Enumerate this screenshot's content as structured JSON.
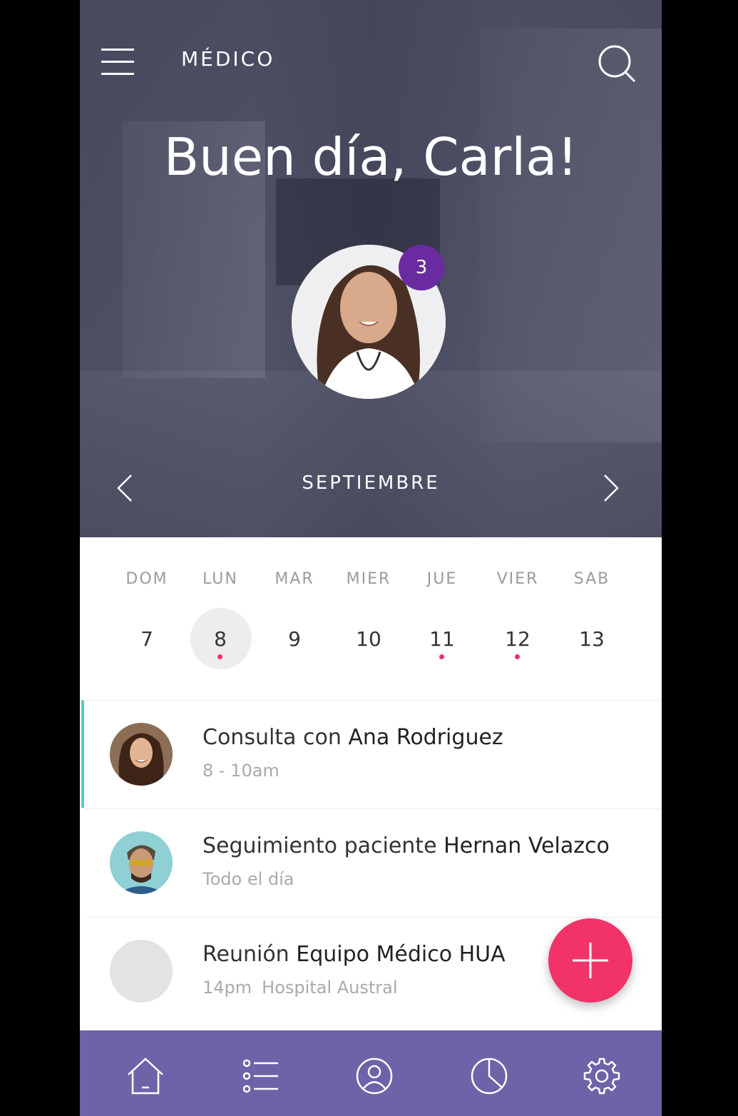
{
  "header": {
    "app_title": "MÉDICO",
    "greeting": "Buen día, Carla!",
    "notification_count": "3",
    "month": "SEPTIEMBRE"
  },
  "week": {
    "days": [
      {
        "dow": "DOM",
        "num": "7",
        "selected": false,
        "has_event": false
      },
      {
        "dow": "LUN",
        "num": "8",
        "selected": true,
        "has_event": true
      },
      {
        "dow": "MAR",
        "num": "9",
        "selected": false,
        "has_event": false
      },
      {
        "dow": "MIER",
        "num": "10",
        "selected": false,
        "has_event": false
      },
      {
        "dow": "JUE",
        "num": "11",
        "selected": false,
        "has_event": true
      },
      {
        "dow": "VIER",
        "num": "12",
        "selected": false,
        "has_event": true
      },
      {
        "dow": "SAB",
        "num": "13",
        "selected": false,
        "has_event": false
      }
    ]
  },
  "events": [
    {
      "prefix": "Consulta con ",
      "name": "Ana Rodriguez",
      "time": "8 - 10am",
      "place": ""
    },
    {
      "prefix": "Seguimiento paciente ",
      "name": "Hernan Velazco",
      "time": "Todo el día",
      "place": ""
    },
    {
      "prefix": "Reunión ",
      "name": "Equipo Médico HUA",
      "time": "14pm",
      "place": "Hospital Austral"
    }
  ],
  "nav": [
    "home-icon",
    "list-icon",
    "profile-icon",
    "chart-icon",
    "settings-icon"
  ],
  "colors": {
    "accent": "#f2336a",
    "badge": "#6a2aa0",
    "nav_bg": "#6d63a8",
    "active_event": "#54d0be",
    "event_dot": "#e8336a"
  }
}
